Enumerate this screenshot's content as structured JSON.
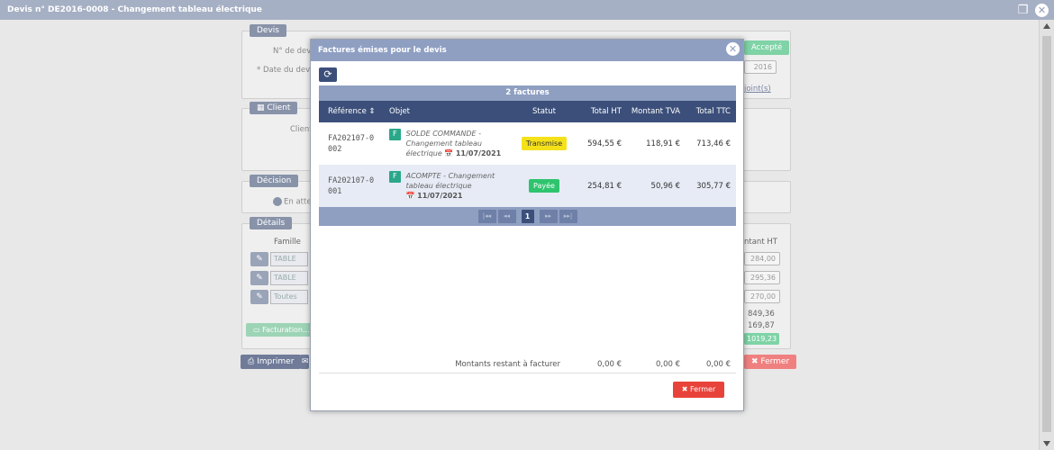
{
  "window": {
    "title": "Devis n° DE2016-0008 - Changement tableau électrique"
  },
  "background": {
    "devis_legend": "Devis",
    "num_devis_label": "N° de devis",
    "date_devis_label": "* Date du devis",
    "date_value": "2016",
    "accepte": "Accepté",
    "joint_link": "joint(s)",
    "client_legend": "Client",
    "client_label": "Client",
    "decision_legend": "Décision",
    "decision_option": "En atte",
    "details_legend": "Détails",
    "famille_header": "Famille",
    "montant_ht_header": "ntant HT",
    "rows": [
      {
        "famille": "TABLE",
        "montant": "284,00"
      },
      {
        "famille": "TABLE",
        "montant": "295,36"
      },
      {
        "famille": "Toutes",
        "montant": "270,00"
      }
    ],
    "total_ht": "849,36",
    "total_tva": "169,87",
    "total_ttc": "1019,23",
    "facturation_btn": "Facturation...",
    "imprimer_btn": "Imprimer",
    "fermer_btn": "Fermer"
  },
  "modal": {
    "title": "Factures émises pour le devis",
    "count_label": "2 factures",
    "columns": {
      "reference": "Référence",
      "objet": "Objet",
      "statut": "Statut",
      "total_ht": "Total HT",
      "montant_tva": "Montant TVA",
      "total_ttc": "Total TTC"
    },
    "invoices": [
      {
        "ref_line1": "FA202107-0",
        "ref_line2": "002",
        "type": "F",
        "objet": "SOLDE COMMANDE - Changement tableau électrique",
        "date": "11/07/2021",
        "statut": "Transmise",
        "total_ht": "594,55 €",
        "montant_tva": "118,91 €",
        "total_ttc": "713,46 €"
      },
      {
        "ref_line1": "FA202107-0",
        "ref_line2": "001",
        "type": "F",
        "objet": "ACOMPTE - Changement tableau électrique",
        "date": "11/07/2021",
        "statut": "Payée",
        "total_ht": "254,81 €",
        "montant_tva": "50,96 €",
        "total_ttc": "305,77 €"
      }
    ],
    "pager": {
      "current_page": "1"
    },
    "remaining": {
      "label": "Montants restant à facturer",
      "ht": "0,00 €",
      "tva": "0,00 €",
      "ttc": "0,00 €"
    },
    "close_button": "Fermer"
  }
}
